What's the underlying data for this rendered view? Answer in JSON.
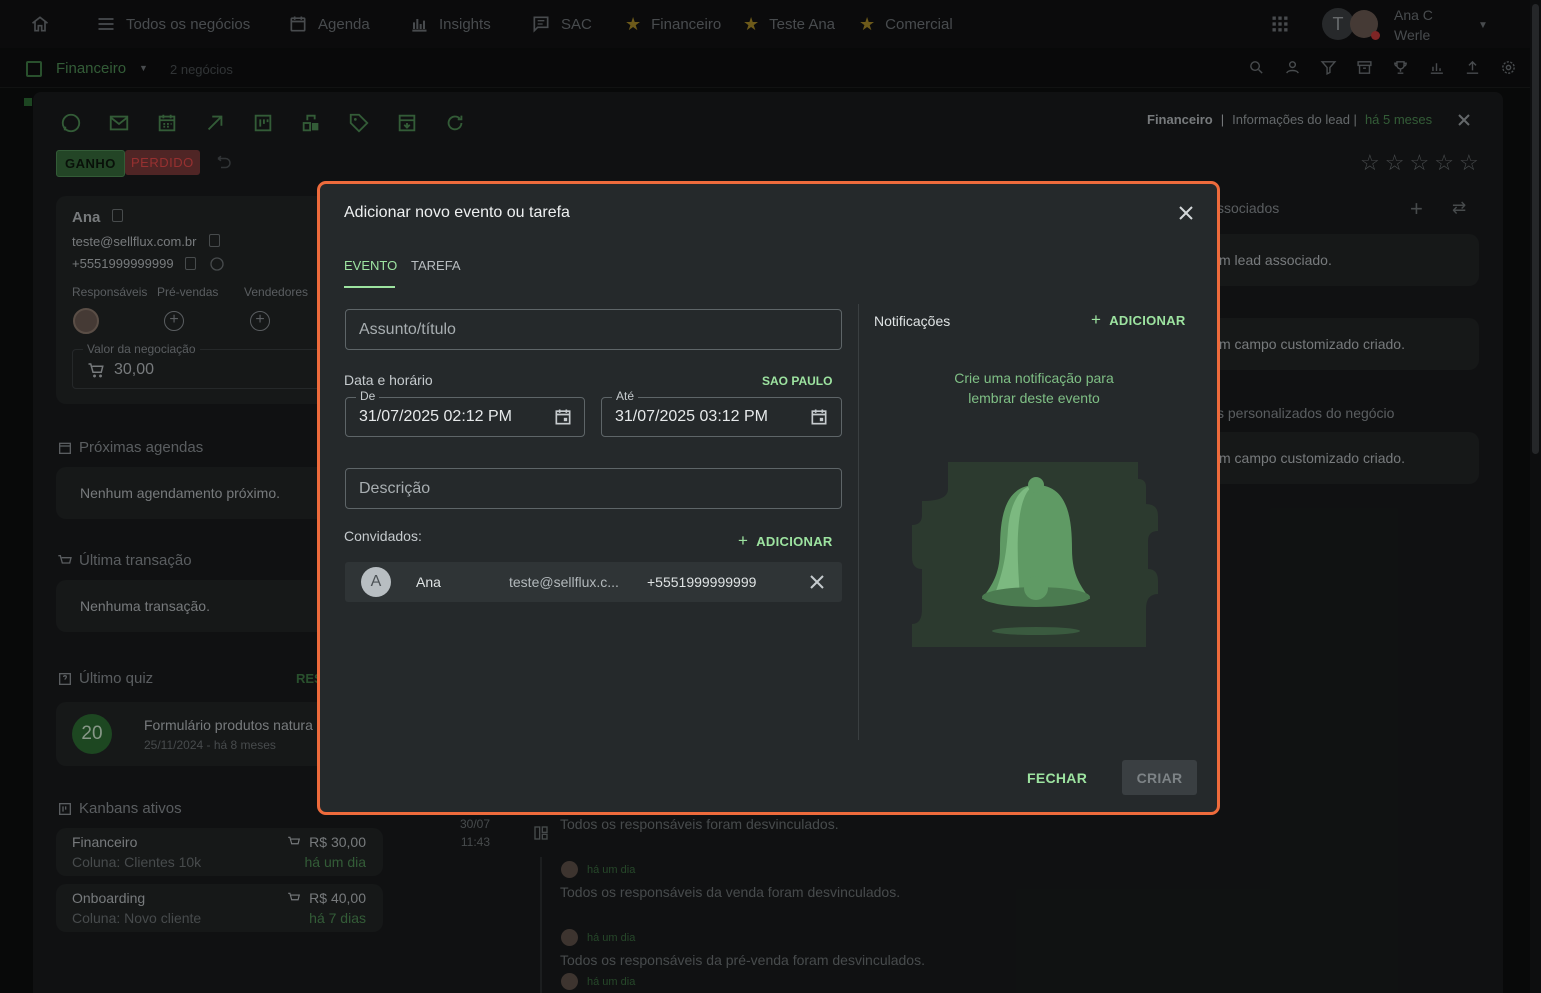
{
  "nav": {
    "home_icon": "home-icon",
    "items": [
      "Todos os negócios",
      "Agenda",
      "Insights",
      "SAC",
      "Financeiro",
      "Teste Ana",
      "Comercial"
    ],
    "user_initial": "T",
    "user_name_line1": "Ana C",
    "user_name_line2": "Werle"
  },
  "subbar": {
    "pipeline": "Financeiro",
    "count": "2 negócios"
  },
  "drawer": {
    "header_kanban": "Financeiro",
    "header_sep": "|",
    "header_info": "Informações do lead |",
    "header_time": "há 5 meses",
    "badge_won": "GANHO",
    "badge_lost": "PERDIDO",
    "contact": {
      "name": "Ana",
      "email": "teste@sellflux.com.br",
      "phone": "+5551999999999",
      "roles": [
        "Responsáveis",
        "Pré-vendas",
        "Vendedores"
      ],
      "deal_value_label": "Valor da negociação",
      "deal_value": "30,00"
    },
    "next_events_title": "Próximas agendas",
    "next_events_empty": "Nenhum agendamento próximo.",
    "last_tx_title": "Última transação",
    "last_tx_empty": "Nenhuma transação.",
    "last_quiz_title": "Último quiz",
    "last_quiz_action": "RES",
    "quiz": {
      "score": "20",
      "name": "Formulário produtos natura",
      "date": "25/11/2024 - há 8 meses"
    },
    "kanbans_title": "Kanbans ativos",
    "kanbans": [
      {
        "name": "Financeiro",
        "column": "Coluna: Clientes 10k",
        "value": "R$ 30,00",
        "time": "há um dia"
      },
      {
        "name": "Onboarding",
        "column": "Coluna: Novo cliente",
        "value": "R$ 40,00",
        "time": "há 7 dias"
      }
    ],
    "right": {
      "assoc_title": "ssociados",
      "assoc_empty": "m lead associado.",
      "custom_empty_1": "m campo customizado criado.",
      "custom_title": "s personalizados do negócio",
      "custom_empty_2": "m campo customizado criado."
    },
    "timeline": {
      "date": "30/07",
      "time": "11:43",
      "entries": [
        {
          "ago": "",
          "text": "Todos os responsáveis foram desvinculados."
        },
        {
          "ago": "há um dia",
          "text": "Todos os responsáveis da venda foram desvinculados."
        },
        {
          "ago": "há um dia",
          "text": "Todos os responsáveis da pré-venda foram desvinculados."
        },
        {
          "ago": "há um dia",
          "text": ""
        }
      ]
    }
  },
  "modal": {
    "title": "Adicionar novo evento ou tarefa",
    "tabs": [
      "EVENTO",
      "TAREFA"
    ],
    "subject_placeholder": "Assunto/título",
    "datetime_label": "Data e horário",
    "timezone": "SAO PAULO",
    "from_label": "De",
    "from_value": "31/07/2025 02:12 PM",
    "to_label": "Até",
    "to_value": "31/07/2025 03:12 PM",
    "description_placeholder": "Descrição",
    "guests_label": "Convidados:",
    "add_label": "ADICIONAR",
    "guest": {
      "initial": "A",
      "name": "Ana",
      "email": "teste@sellflux.c...",
      "phone": "+5551999999999"
    },
    "notifications_title": "Notificações",
    "notifications_empty": "Crie uma notificação para lembrar deste evento",
    "close_label": "FECHAR",
    "create_label": "CRIAR"
  }
}
